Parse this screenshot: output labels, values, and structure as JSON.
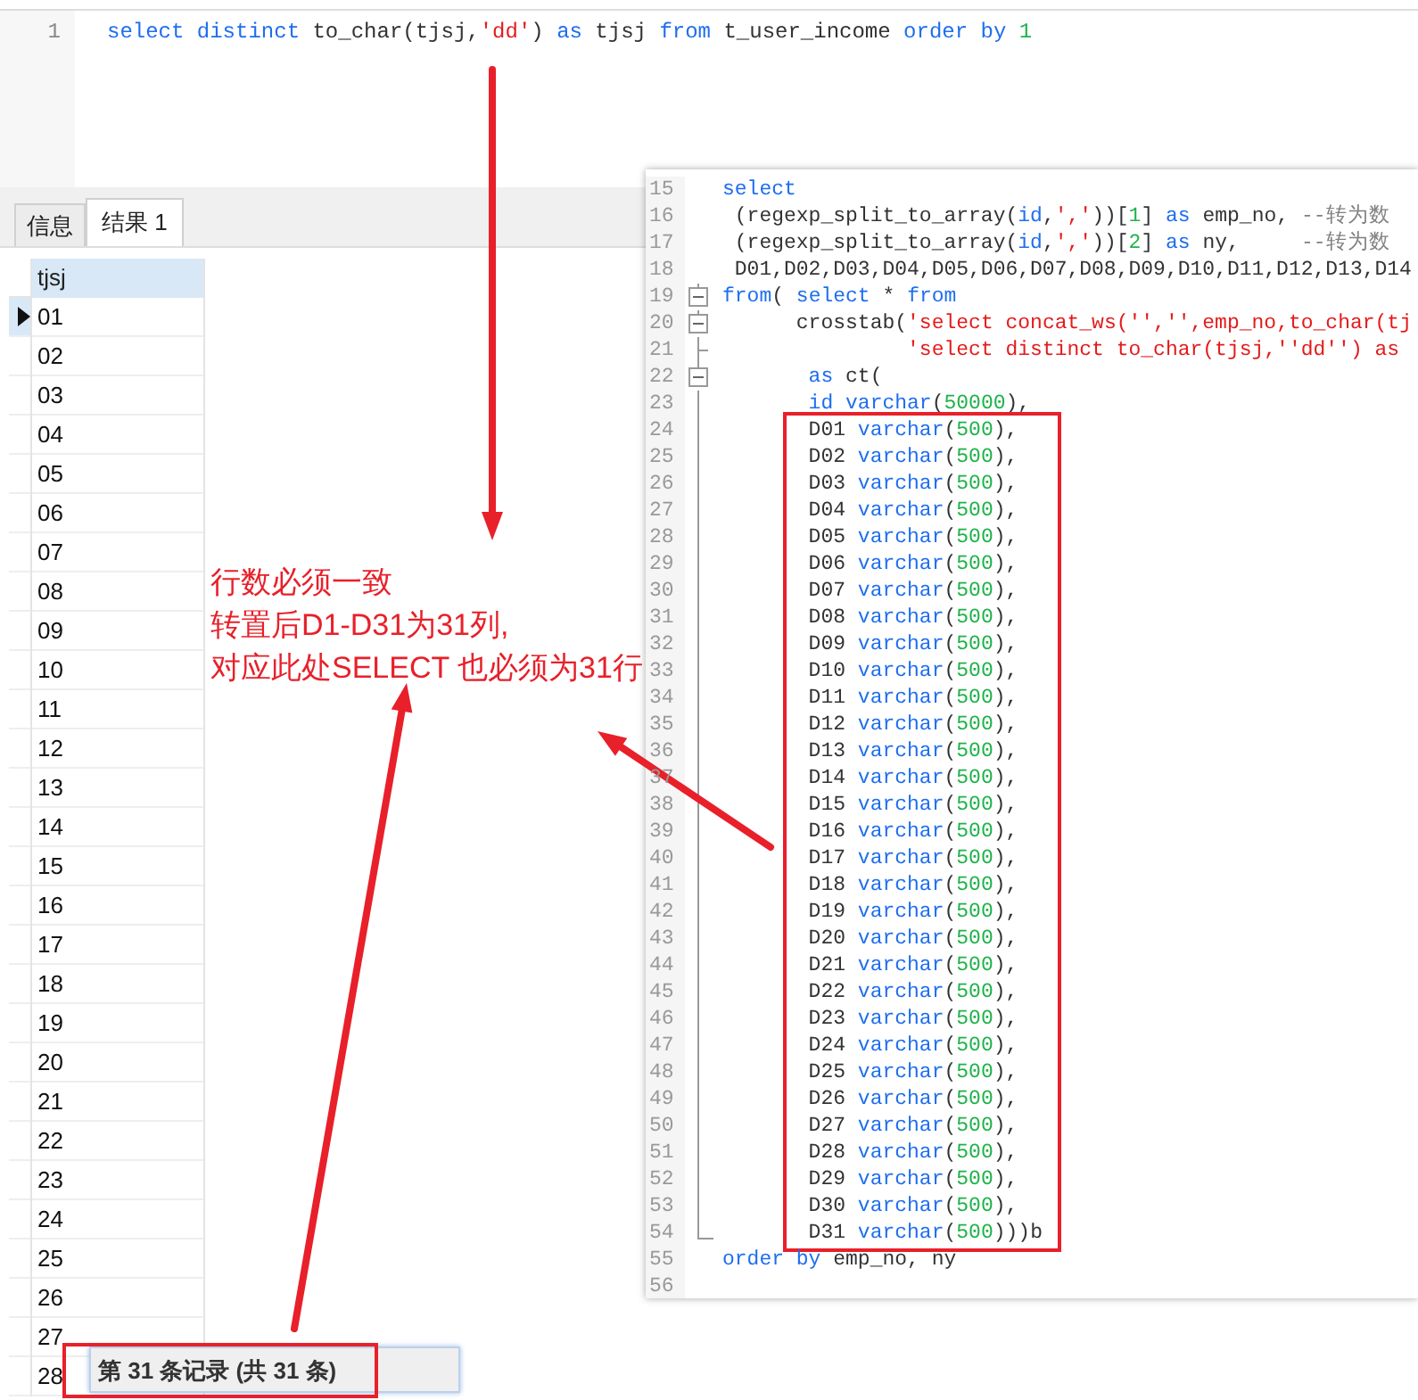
{
  "editor": {
    "lines": [
      {
        "number": "1",
        "tokens": [
          {
            "kind": "keyword",
            "text": "select distinct"
          },
          {
            "kind": "plain",
            "text": " to_char(tjsj,"
          },
          {
            "kind": "string",
            "text": "'dd'"
          },
          {
            "kind": "plain",
            "text": ") "
          },
          {
            "kind": "keyword",
            "text": "as"
          },
          {
            "kind": "plain",
            "text": " tjsj "
          },
          {
            "kind": "keyword",
            "text": "from"
          },
          {
            "kind": "plain",
            "text": " t_user_income "
          },
          {
            "kind": "keyword",
            "text": "order by "
          },
          {
            "kind": "number",
            "text": "1"
          }
        ]
      }
    ]
  },
  "result_tabs": [
    {
      "label": "信息",
      "selected": false
    },
    {
      "label": "结果 1",
      "selected": true
    }
  ],
  "grid": {
    "columns": [
      "tjsj"
    ],
    "rows": [
      {
        "cells": [
          "01"
        ],
        "current": true
      },
      {
        "cells": [
          "02"
        ],
        "current": false
      },
      {
        "cells": [
          "03"
        ],
        "current": false
      },
      {
        "cells": [
          "04"
        ],
        "current": false
      },
      {
        "cells": [
          "05"
        ],
        "current": false
      },
      {
        "cells": [
          "06"
        ],
        "current": false
      },
      {
        "cells": [
          "07"
        ],
        "current": false
      },
      {
        "cells": [
          "08"
        ],
        "current": false
      },
      {
        "cells": [
          "09"
        ],
        "current": false
      },
      {
        "cells": [
          "10"
        ],
        "current": false
      },
      {
        "cells": [
          "11"
        ],
        "current": false
      },
      {
        "cells": [
          "12"
        ],
        "current": false
      },
      {
        "cells": [
          "13"
        ],
        "current": false
      },
      {
        "cells": [
          "14"
        ],
        "current": false
      },
      {
        "cells": [
          "15"
        ],
        "current": false
      },
      {
        "cells": [
          "16"
        ],
        "current": false
      },
      {
        "cells": [
          "17"
        ],
        "current": false
      },
      {
        "cells": [
          "18"
        ],
        "current": false
      },
      {
        "cells": [
          "19"
        ],
        "current": false
      },
      {
        "cells": [
          "20"
        ],
        "current": false
      },
      {
        "cells": [
          "21"
        ],
        "current": false
      },
      {
        "cells": [
          "22"
        ],
        "current": false
      },
      {
        "cells": [
          "23"
        ],
        "current": false
      },
      {
        "cells": [
          "24"
        ],
        "current": false
      },
      {
        "cells": [
          "25"
        ],
        "current": false
      },
      {
        "cells": [
          "26"
        ],
        "current": false
      },
      {
        "cells": [
          "27"
        ],
        "current": false
      },
      {
        "cells": [
          "28"
        ],
        "current": false
      }
    ]
  },
  "status": {
    "text": "第 31 条记录 (共 31 条)",
    "boxed": true
  },
  "code_panel": {
    "lines": [
      {
        "number": "15",
        "kind": "plain",
        "boxed": false,
        "tokens": [
          {
            "kind": "keyword",
            "text": "select"
          }
        ]
      },
      {
        "number": "16",
        "kind": "plain",
        "boxed": false,
        "tokens": [
          {
            "kind": "plain",
            "text": " (regexp_split_to_array("
          },
          {
            "kind": "keyword",
            "text": "id"
          },
          {
            "kind": "plain",
            "text": ","
          },
          {
            "kind": "string",
            "text": "','"
          },
          {
            "kind": "plain",
            "text": "))["
          },
          {
            "kind": "number",
            "text": "1"
          },
          {
            "kind": "plain",
            "text": "] "
          },
          {
            "kind": "keyword",
            "text": "as"
          },
          {
            "kind": "plain",
            "text": " emp_no, "
          },
          {
            "kind": "comment",
            "text": "--转为数"
          }
        ]
      },
      {
        "number": "17",
        "kind": "plain",
        "boxed": false,
        "tokens": [
          {
            "kind": "plain",
            "text": " (regexp_split_to_array("
          },
          {
            "kind": "keyword",
            "text": "id"
          },
          {
            "kind": "plain",
            "text": ","
          },
          {
            "kind": "string",
            "text": "','"
          },
          {
            "kind": "plain",
            "text": "))["
          },
          {
            "kind": "number",
            "text": "2"
          },
          {
            "kind": "plain",
            "text": "] "
          },
          {
            "kind": "keyword",
            "text": "as"
          },
          {
            "kind": "plain",
            "text": " ny,     "
          },
          {
            "kind": "comment",
            "text": "--转为数"
          }
        ]
      },
      {
        "number": "18",
        "kind": "plain",
        "boxed": false,
        "tokens": [
          {
            "kind": "plain",
            "text": " D01,D02,D03,D04,D05,D06,D07,D08,D09,D10,D11,D12,D13,D14"
          }
        ]
      },
      {
        "number": "19",
        "kind": "fold_start",
        "boxed": false,
        "tokens": [
          {
            "kind": "keyword",
            "text": "from"
          },
          {
            "kind": "plain",
            "text": "( "
          },
          {
            "kind": "keyword",
            "text": "select"
          },
          {
            "kind": "plain",
            "text": " * "
          },
          {
            "kind": "keyword",
            "text": "from"
          }
        ]
      },
      {
        "number": "20",
        "kind": "fold_start",
        "boxed": false,
        "tokens": [
          {
            "kind": "plain",
            "text": "      crosstab("
          },
          {
            "kind": "string",
            "text": "'select concat_ws('','',emp_no,to_char(tj"
          }
        ]
      },
      {
        "number": "21",
        "kind": "fold_branch",
        "boxed": false,
        "tokens": [
          {
            "kind": "string",
            "text": "               'select distinct to_char(tjsj,''dd'') as"
          }
        ]
      },
      {
        "number": "22",
        "kind": "fold_start",
        "boxed": false,
        "tokens": [
          {
            "kind": "keyword",
            "text": "       as"
          },
          {
            "kind": "plain",
            "text": " ct("
          }
        ]
      },
      {
        "number": "23",
        "kind": "fold_line",
        "boxed": false,
        "tokens": [
          {
            "kind": "keyword",
            "text": "       id varchar"
          },
          {
            "kind": "plain",
            "text": "("
          },
          {
            "kind": "number",
            "text": "50000"
          },
          {
            "kind": "plain",
            "text": "),"
          }
        ]
      },
      {
        "number": "24",
        "kind": "fold_line",
        "boxed": true,
        "tokens": [
          {
            "kind": "plain",
            "text": "       D01 "
          },
          {
            "kind": "keyword",
            "text": "varchar"
          },
          {
            "kind": "plain",
            "text": "("
          },
          {
            "kind": "number",
            "text": "500"
          },
          {
            "kind": "plain",
            "text": "),"
          }
        ]
      },
      {
        "number": "25",
        "kind": "fold_line",
        "boxed": true,
        "tokens": [
          {
            "kind": "plain",
            "text": "       D02 "
          },
          {
            "kind": "keyword",
            "text": "varchar"
          },
          {
            "kind": "plain",
            "text": "("
          },
          {
            "kind": "number",
            "text": "500"
          },
          {
            "kind": "plain",
            "text": "),"
          }
        ]
      },
      {
        "number": "26",
        "kind": "fold_line",
        "boxed": true,
        "tokens": [
          {
            "kind": "plain",
            "text": "       D03 "
          },
          {
            "kind": "keyword",
            "text": "varchar"
          },
          {
            "kind": "plain",
            "text": "("
          },
          {
            "kind": "number",
            "text": "500"
          },
          {
            "kind": "plain",
            "text": "),"
          }
        ]
      },
      {
        "number": "27",
        "kind": "fold_line",
        "boxed": true,
        "tokens": [
          {
            "kind": "plain",
            "text": "       D04 "
          },
          {
            "kind": "keyword",
            "text": "varchar"
          },
          {
            "kind": "plain",
            "text": "("
          },
          {
            "kind": "number",
            "text": "500"
          },
          {
            "kind": "plain",
            "text": "),"
          }
        ]
      },
      {
        "number": "28",
        "kind": "fold_line",
        "boxed": true,
        "tokens": [
          {
            "kind": "plain",
            "text": "       D05 "
          },
          {
            "kind": "keyword",
            "text": "varchar"
          },
          {
            "kind": "plain",
            "text": "("
          },
          {
            "kind": "number",
            "text": "500"
          },
          {
            "kind": "plain",
            "text": "),"
          }
        ]
      },
      {
        "number": "29",
        "kind": "fold_line",
        "boxed": true,
        "tokens": [
          {
            "kind": "plain",
            "text": "       D06 "
          },
          {
            "kind": "keyword",
            "text": "varchar"
          },
          {
            "kind": "plain",
            "text": "("
          },
          {
            "kind": "number",
            "text": "500"
          },
          {
            "kind": "plain",
            "text": "),"
          }
        ]
      },
      {
        "number": "30",
        "kind": "fold_line",
        "boxed": true,
        "tokens": [
          {
            "kind": "plain",
            "text": "       D07 "
          },
          {
            "kind": "keyword",
            "text": "varchar"
          },
          {
            "kind": "plain",
            "text": "("
          },
          {
            "kind": "number",
            "text": "500"
          },
          {
            "kind": "plain",
            "text": "),"
          }
        ]
      },
      {
        "number": "31",
        "kind": "fold_line",
        "boxed": true,
        "tokens": [
          {
            "kind": "plain",
            "text": "       D08 "
          },
          {
            "kind": "keyword",
            "text": "varchar"
          },
          {
            "kind": "plain",
            "text": "("
          },
          {
            "kind": "number",
            "text": "500"
          },
          {
            "kind": "plain",
            "text": "),"
          }
        ]
      },
      {
        "number": "32",
        "kind": "fold_line",
        "boxed": true,
        "tokens": [
          {
            "kind": "plain",
            "text": "       D09 "
          },
          {
            "kind": "keyword",
            "text": "varchar"
          },
          {
            "kind": "plain",
            "text": "("
          },
          {
            "kind": "number",
            "text": "500"
          },
          {
            "kind": "plain",
            "text": "),"
          }
        ]
      },
      {
        "number": "33",
        "kind": "fold_line",
        "boxed": true,
        "tokens": [
          {
            "kind": "plain",
            "text": "       D10 "
          },
          {
            "kind": "keyword",
            "text": "varchar"
          },
          {
            "kind": "plain",
            "text": "("
          },
          {
            "kind": "number",
            "text": "500"
          },
          {
            "kind": "plain",
            "text": "),"
          }
        ]
      },
      {
        "number": "34",
        "kind": "fold_line",
        "boxed": true,
        "tokens": [
          {
            "kind": "plain",
            "text": "       D11 "
          },
          {
            "kind": "keyword",
            "text": "varchar"
          },
          {
            "kind": "plain",
            "text": "("
          },
          {
            "kind": "number",
            "text": "500"
          },
          {
            "kind": "plain",
            "text": "),"
          }
        ]
      },
      {
        "number": "35",
        "kind": "fold_line",
        "boxed": true,
        "tokens": [
          {
            "kind": "plain",
            "text": "       D12 "
          },
          {
            "kind": "keyword",
            "text": "varchar"
          },
          {
            "kind": "plain",
            "text": "("
          },
          {
            "kind": "number",
            "text": "500"
          },
          {
            "kind": "plain",
            "text": "),"
          }
        ]
      },
      {
        "number": "36",
        "kind": "fold_line",
        "boxed": true,
        "tokens": [
          {
            "kind": "plain",
            "text": "       D13 "
          },
          {
            "kind": "keyword",
            "text": "varchar"
          },
          {
            "kind": "plain",
            "text": "("
          },
          {
            "kind": "number",
            "text": "500"
          },
          {
            "kind": "plain",
            "text": "),"
          }
        ]
      },
      {
        "number": "37",
        "kind": "fold_line",
        "boxed": true,
        "tokens": [
          {
            "kind": "plain",
            "text": "       D14 "
          },
          {
            "kind": "keyword",
            "text": "varchar"
          },
          {
            "kind": "plain",
            "text": "("
          },
          {
            "kind": "number",
            "text": "500"
          },
          {
            "kind": "plain",
            "text": "),"
          }
        ]
      },
      {
        "number": "38",
        "kind": "fold_line",
        "boxed": true,
        "tokens": [
          {
            "kind": "plain",
            "text": "       D15 "
          },
          {
            "kind": "keyword",
            "text": "varchar"
          },
          {
            "kind": "plain",
            "text": "("
          },
          {
            "kind": "number",
            "text": "500"
          },
          {
            "kind": "plain",
            "text": "),"
          }
        ]
      },
      {
        "number": "39",
        "kind": "fold_line",
        "boxed": true,
        "tokens": [
          {
            "kind": "plain",
            "text": "       D16 "
          },
          {
            "kind": "keyword",
            "text": "varchar"
          },
          {
            "kind": "plain",
            "text": "("
          },
          {
            "kind": "number",
            "text": "500"
          },
          {
            "kind": "plain",
            "text": "),"
          }
        ]
      },
      {
        "number": "40",
        "kind": "fold_line",
        "boxed": true,
        "tokens": [
          {
            "kind": "plain",
            "text": "       D17 "
          },
          {
            "kind": "keyword",
            "text": "varchar"
          },
          {
            "kind": "plain",
            "text": "("
          },
          {
            "kind": "number",
            "text": "500"
          },
          {
            "kind": "plain",
            "text": "),"
          }
        ]
      },
      {
        "number": "41",
        "kind": "fold_line",
        "boxed": true,
        "tokens": [
          {
            "kind": "plain",
            "text": "       D18 "
          },
          {
            "kind": "keyword",
            "text": "varchar"
          },
          {
            "kind": "plain",
            "text": "("
          },
          {
            "kind": "number",
            "text": "500"
          },
          {
            "kind": "plain",
            "text": "),"
          }
        ]
      },
      {
        "number": "42",
        "kind": "fold_line",
        "boxed": true,
        "tokens": [
          {
            "kind": "plain",
            "text": "       D19 "
          },
          {
            "kind": "keyword",
            "text": "varchar"
          },
          {
            "kind": "plain",
            "text": "("
          },
          {
            "kind": "number",
            "text": "500"
          },
          {
            "kind": "plain",
            "text": "),"
          }
        ]
      },
      {
        "number": "43",
        "kind": "fold_line",
        "boxed": true,
        "tokens": [
          {
            "kind": "plain",
            "text": "       D20 "
          },
          {
            "kind": "keyword",
            "text": "varchar"
          },
          {
            "kind": "plain",
            "text": "("
          },
          {
            "kind": "number",
            "text": "500"
          },
          {
            "kind": "plain",
            "text": "),"
          }
        ]
      },
      {
        "number": "44",
        "kind": "fold_line",
        "boxed": true,
        "tokens": [
          {
            "kind": "plain",
            "text": "       D21 "
          },
          {
            "kind": "keyword",
            "text": "varchar"
          },
          {
            "kind": "plain",
            "text": "("
          },
          {
            "kind": "number",
            "text": "500"
          },
          {
            "kind": "plain",
            "text": "),"
          }
        ]
      },
      {
        "number": "45",
        "kind": "fold_line",
        "boxed": true,
        "tokens": [
          {
            "kind": "plain",
            "text": "       D22 "
          },
          {
            "kind": "keyword",
            "text": "varchar"
          },
          {
            "kind": "plain",
            "text": "("
          },
          {
            "kind": "number",
            "text": "500"
          },
          {
            "kind": "plain",
            "text": "),"
          }
        ]
      },
      {
        "number": "46",
        "kind": "fold_line",
        "boxed": true,
        "tokens": [
          {
            "kind": "plain",
            "text": "       D23 "
          },
          {
            "kind": "keyword",
            "text": "varchar"
          },
          {
            "kind": "plain",
            "text": "("
          },
          {
            "kind": "number",
            "text": "500"
          },
          {
            "kind": "plain",
            "text": "),"
          }
        ]
      },
      {
        "number": "47",
        "kind": "fold_line",
        "boxed": true,
        "tokens": [
          {
            "kind": "plain",
            "text": "       D24 "
          },
          {
            "kind": "keyword",
            "text": "varchar"
          },
          {
            "kind": "plain",
            "text": "("
          },
          {
            "kind": "number",
            "text": "500"
          },
          {
            "kind": "plain",
            "text": "),"
          }
        ]
      },
      {
        "number": "48",
        "kind": "fold_line",
        "boxed": true,
        "tokens": [
          {
            "kind": "plain",
            "text": "       D25 "
          },
          {
            "kind": "keyword",
            "text": "varchar"
          },
          {
            "kind": "plain",
            "text": "("
          },
          {
            "kind": "number",
            "text": "500"
          },
          {
            "kind": "plain",
            "text": "),"
          }
        ]
      },
      {
        "number": "49",
        "kind": "fold_line",
        "boxed": true,
        "tokens": [
          {
            "kind": "plain",
            "text": "       D26 "
          },
          {
            "kind": "keyword",
            "text": "varchar"
          },
          {
            "kind": "plain",
            "text": "("
          },
          {
            "kind": "number",
            "text": "500"
          },
          {
            "kind": "plain",
            "text": "),"
          }
        ]
      },
      {
        "number": "50",
        "kind": "fold_line",
        "boxed": true,
        "tokens": [
          {
            "kind": "plain",
            "text": "       D27 "
          },
          {
            "kind": "keyword",
            "text": "varchar"
          },
          {
            "kind": "plain",
            "text": "("
          },
          {
            "kind": "number",
            "text": "500"
          },
          {
            "kind": "plain",
            "text": "),"
          }
        ]
      },
      {
        "number": "51",
        "kind": "fold_line",
        "boxed": true,
        "tokens": [
          {
            "kind": "plain",
            "text": "       D28 "
          },
          {
            "kind": "keyword",
            "text": "varchar"
          },
          {
            "kind": "plain",
            "text": "("
          },
          {
            "kind": "number",
            "text": "500"
          },
          {
            "kind": "plain",
            "text": "),"
          }
        ]
      },
      {
        "number": "52",
        "kind": "fold_line",
        "boxed": true,
        "tokens": [
          {
            "kind": "plain",
            "text": "       D29 "
          },
          {
            "kind": "keyword",
            "text": "varchar"
          },
          {
            "kind": "plain",
            "text": "("
          },
          {
            "kind": "number",
            "text": "500"
          },
          {
            "kind": "plain",
            "text": "),"
          }
        ]
      },
      {
        "number": "53",
        "kind": "fold_line",
        "boxed": true,
        "tokens": [
          {
            "kind": "plain",
            "text": "       D30 "
          },
          {
            "kind": "keyword",
            "text": "varchar"
          },
          {
            "kind": "plain",
            "text": "("
          },
          {
            "kind": "number",
            "text": "500"
          },
          {
            "kind": "plain",
            "text": "),"
          }
        ]
      },
      {
        "number": "54",
        "kind": "fold_end",
        "boxed": true,
        "tokens": [
          {
            "kind": "plain",
            "text": "       D31 "
          },
          {
            "kind": "keyword",
            "text": "varchar"
          },
          {
            "kind": "plain",
            "text": "("
          },
          {
            "kind": "number",
            "text": "500"
          },
          {
            "kind": "plain",
            "text": ")))b"
          }
        ]
      },
      {
        "number": "55",
        "kind": "plain",
        "boxed": false,
        "tokens": [
          {
            "kind": "keyword",
            "text": "order by"
          },
          {
            "kind": "plain",
            "text": " emp_no, ny"
          }
        ]
      },
      {
        "number": "56"
      }
    ]
  },
  "annotation": {
    "lines": [
      "行数必须一致",
      "转置后D1-D31为31列,",
      "对应此处SELECT 也必须为31行"
    ]
  }
}
